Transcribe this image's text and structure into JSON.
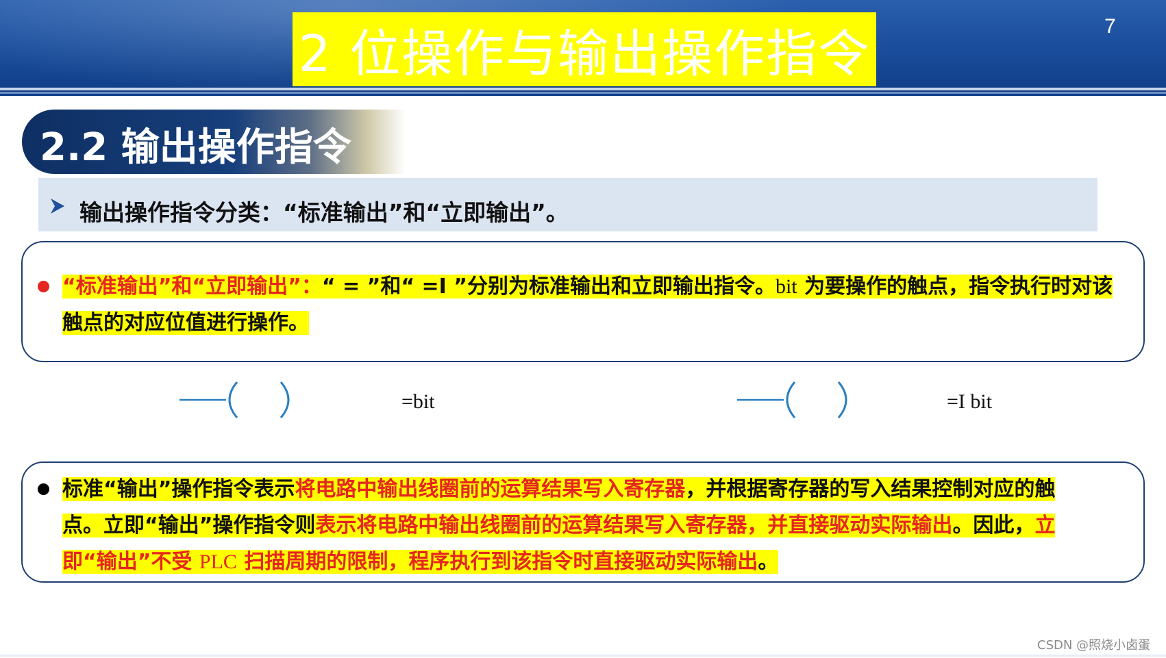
{
  "slide": {
    "title": "2 位操作与输出操作指令",
    "page_number": "7"
  },
  "section": {
    "title": "2.2 输出操作指令"
  },
  "subtitle": {
    "text": "输出操作指令分类：“标准输出”和“立即输出”。"
  },
  "box1": {
    "seg1": "“标准输出”和“立即输出”：",
    "seg2": "“ = ”和“ =I ”分别为标准输出和立即输出指令。",
    "seg3": "bit",
    "seg4": " 为要操作的触点，指令执行时对该",
    "line2": "触点的对应位值进行操作。"
  },
  "coils": {
    "left_label": "=bit",
    "right_label": "=I bit"
  },
  "box2": {
    "l1_a": "标准“输出”操作指令表示",
    "l1_b": "将电路中输出线圈前的运算结果写入寄存器",
    "l1_c": "，并根据寄存器的写入结果控制对应的触",
    "l2_a": "点。立即“输出”操作指令则",
    "l2_b": "表示将电路中输出线圈前的运算结果写入寄存器，并直接驱动实际输出",
    "l2_c": "。因此，",
    "l2_d": "立",
    "l3_a": "即“输出”不受 ",
    "l3_b": "PLC",
    "l3_c": " 扫描周期的限制，程序执行到该指令时直接驱动实际输出",
    "l3_d": "。"
  },
  "watermark": "CSDN @照烧小卤蛋",
  "colors": {
    "banner": "#1b4f9e",
    "title_highlight": "#ffff00",
    "section_pill": "#0e2f63",
    "subtitle_bg": "#dbe4f1",
    "emphasis_red": "#e5261f",
    "coil_blue": "#2a7fbf"
  }
}
